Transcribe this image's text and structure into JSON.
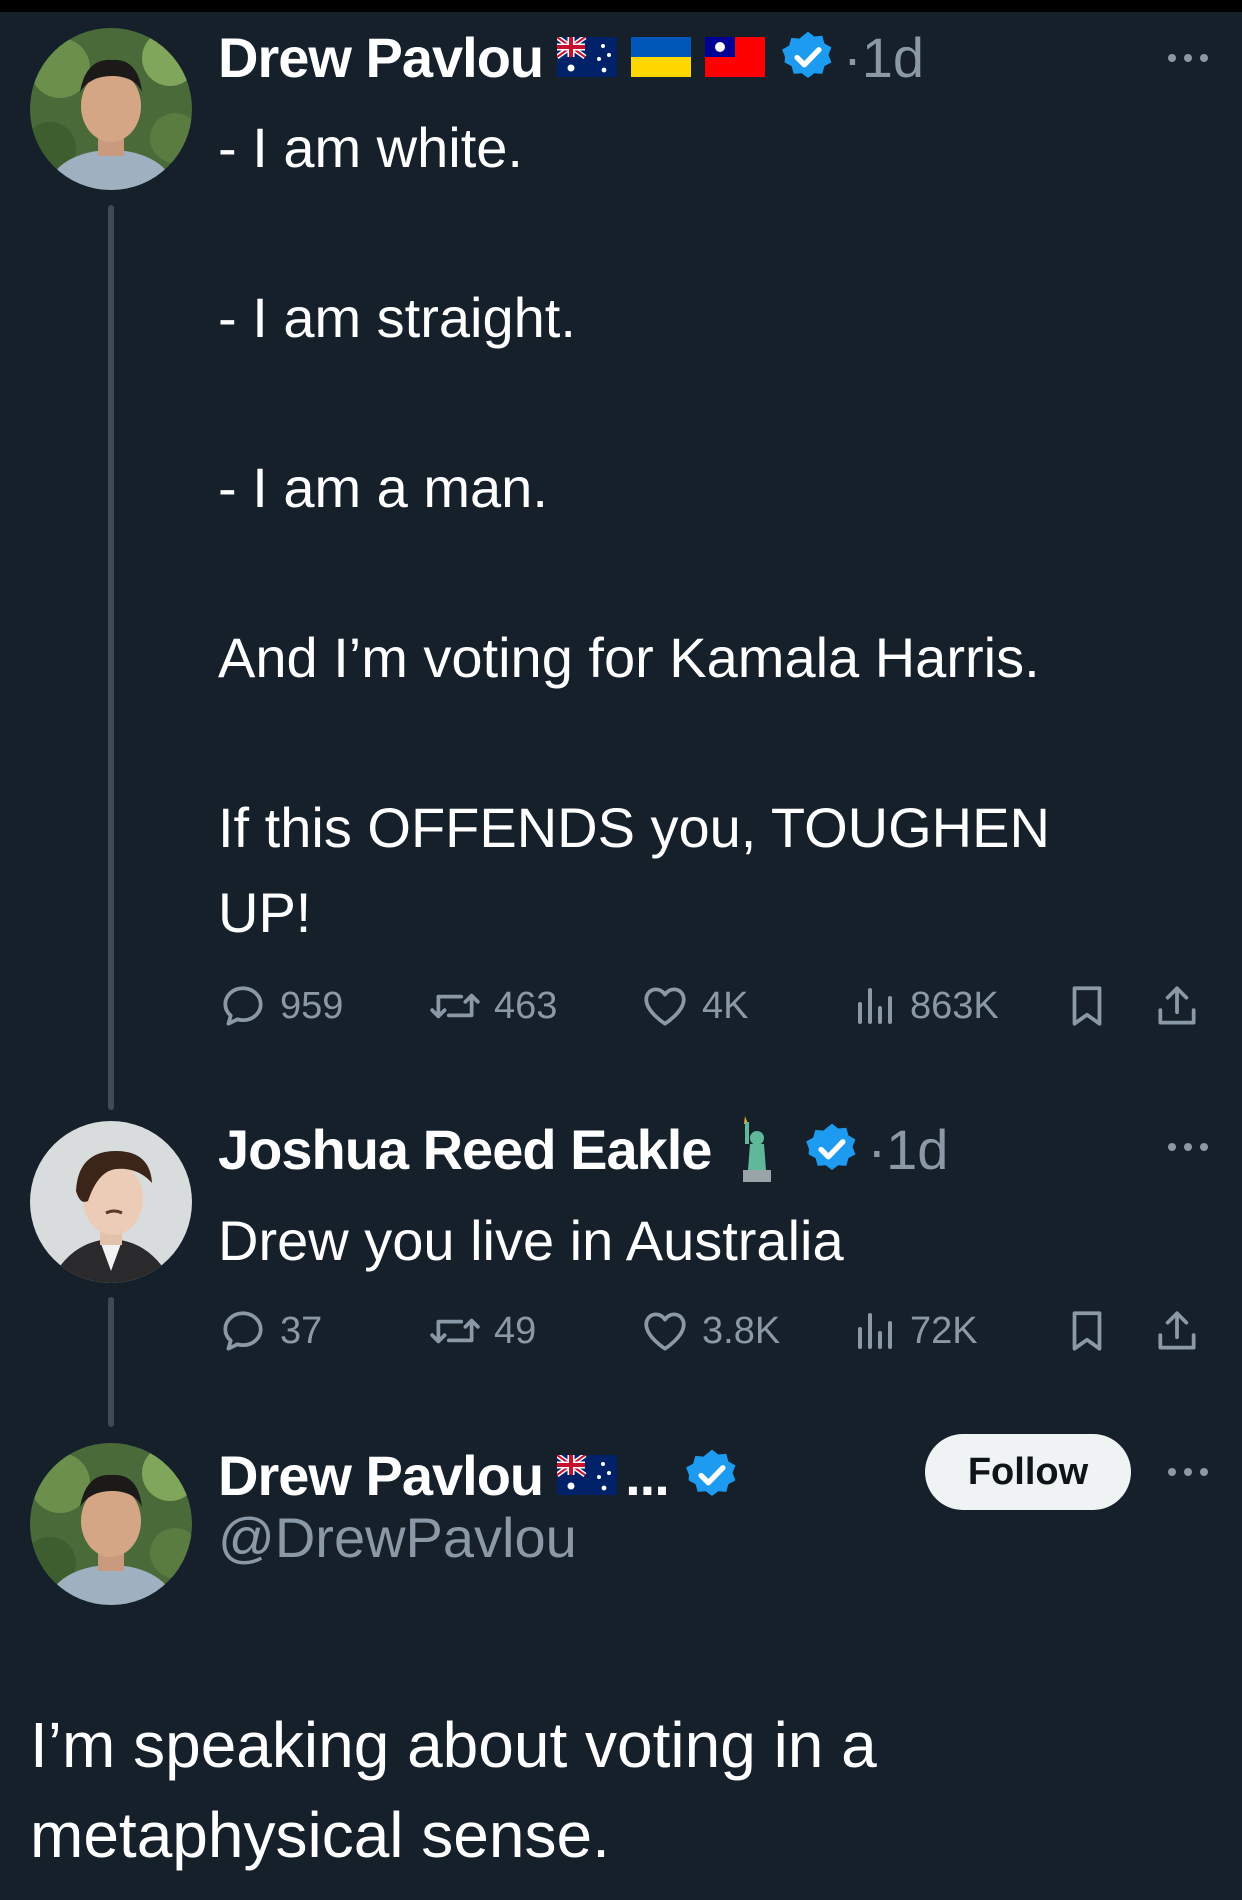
{
  "colors": {
    "background": "#15202b",
    "muted": "#8b98a5",
    "verified": "#1d9bf0",
    "thread_line": "#3e4a56"
  },
  "icons": [
    "flag-australia-icon",
    "flag-ukraine-icon",
    "flag-taiwan-icon",
    "verified-badge-icon",
    "statue-of-liberty-icon",
    "more-icon",
    "reply-icon",
    "retweet-icon",
    "like-icon",
    "views-icon",
    "bookmark-icon",
    "share-icon"
  ],
  "tweet1": {
    "author": "Drew Pavlou",
    "time": "·1d",
    "text": "- I am white.\n\n- I am straight.\n\n- I am a man.\n\nAnd I’m voting for Kamala Harris.\n\nIf this OFFENDS you, TOUGHEN\nUP!",
    "stats": {
      "replies": "959",
      "retweets": "463",
      "likes": "4K",
      "views": "863K"
    }
  },
  "tweet2": {
    "author": "Joshua Reed Eakle",
    "time": "·1d",
    "text": "Drew you live in Australia",
    "stats": {
      "replies": "37",
      "retweets": "49",
      "likes": "3.8K",
      "views": "72K"
    }
  },
  "tweet3": {
    "author": "Drew Pavlou",
    "truncation": "...",
    "handle": "@DrewPavlou",
    "follow_label": "Follow",
    "text": "I’m speaking about voting in a\nmetaphysical sense."
  }
}
